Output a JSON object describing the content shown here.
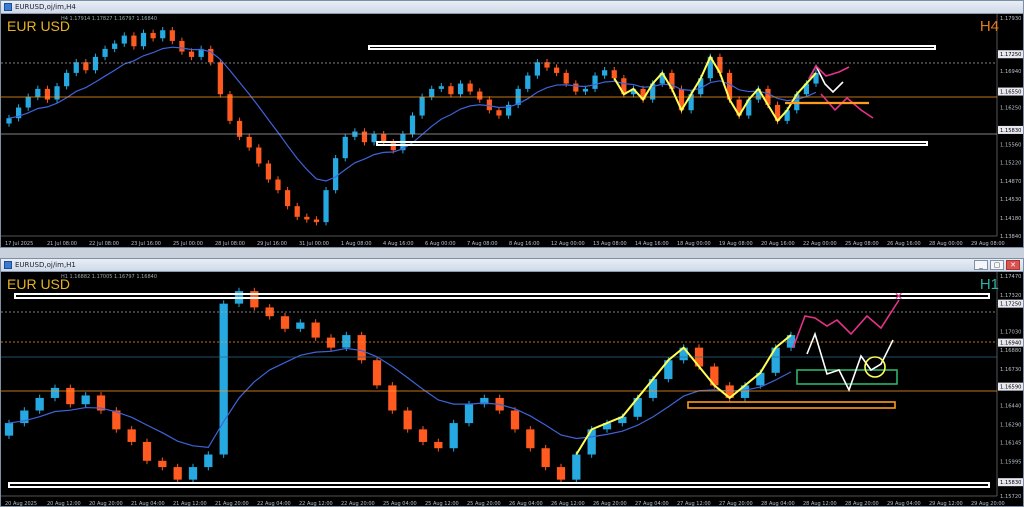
{
  "colors": {
    "bull": "#26a9e0",
    "bear": "#ff5a1f",
    "ma": "#3f63d8",
    "zigzag": "#ffff55",
    "white": "#ffffff",
    "magenta": "#e8318a",
    "orange": "#ff9a1a",
    "green": "#2db36a",
    "grid": "#1a1a1a",
    "axis_text": "#b9c0c8"
  },
  "h4": {
    "title": "EURUSD,oj/im,H4",
    "symbol_label": "EUR USD",
    "timeframe_label": "H4",
    "ohlc_text": "H4 1.17914 1.17827 1.16797 1.16840",
    "price_labels": [
      "1.17930",
      "1.17250",
      "1.16940",
      "1.16550",
      "1.16250",
      "1.15830",
      "1.15560",
      "1.15220",
      "1.14870",
      "1.14530",
      "1.14180",
      "1.13840"
    ],
    "highlight_labels": [
      "1.17250",
      "1.16550",
      "1.15830"
    ],
    "time_labels": [
      "17 Jul 2025",
      "21 Jul 08:00",
      "22 Jul 08:00",
      "23 Jul 16:00",
      "25 Jul 00:00",
      "28 Jul 08:00",
      "29 Jul 16:00",
      "31 Jul 00:00",
      "1 Aug 08:00",
      "4 Aug 16:00",
      "6 Aug 00:00",
      "7 Aug 08:00",
      "8 Aug 16:00",
      "12 Aug 00:00",
      "13 Aug 08:00",
      "14 Aug 16:00",
      "18 Aug 00:00",
      "19 Aug 08:00",
      "20 Aug 16:00",
      "22 Aug 00:00",
      "25 Aug 08:00",
      "26 Aug 16:00",
      "28 Aug 00:00",
      "29 Aug 08:00"
    ]
  },
  "h1": {
    "title": "EURUSD,oj/im,H1",
    "symbol_label": "EUR USD",
    "timeframe_label": "H1",
    "ohlc_text": "H1 1.16882 1.17005 1.16797 1.16840",
    "price_labels": [
      "1.17470",
      "1.17320",
      "1.17250",
      "1.17030",
      "1.16940",
      "1.16880",
      "1.16730",
      "1.16590",
      "1.16440",
      "1.16290",
      "1.16145",
      "1.15995",
      "1.15830",
      "1.15720"
    ],
    "highlight_labels": [
      "1.17250",
      "1.16940",
      "1.16590",
      "1.15830"
    ],
    "time_labels": [
      "20 Aug 2025",
      "20 Aug 12:00",
      "20 Aug 20:00",
      "21 Aug 04:00",
      "21 Aug 12:00",
      "21 Aug 20:00",
      "22 Aug 04:00",
      "22 Aug 12:00",
      "22 Aug 20:00",
      "25 Aug 04:00",
      "25 Aug 12:00",
      "25 Aug 20:00",
      "26 Aug 04:00",
      "26 Aug 12:00",
      "26 Aug 20:00",
      "27 Aug 04:00",
      "27 Aug 12:00",
      "27 Aug 20:00",
      "28 Aug 04:00",
      "28 Aug 12:00",
      "28 Aug 20:00",
      "29 Aug 04:00",
      "29 Aug 12:00",
      "29 Aug 20:00"
    ]
  },
  "window_buttons": [
    "_",
    "▢",
    "✕"
  ],
  "chart_data": [
    {
      "type": "candlestick",
      "title": "EURUSD,oj/im,H4",
      "ylim": [
        1.1384,
        1.1793
      ],
      "series": [
        {
          "name": "close",
          "values": [
            1.1605,
            1.1625,
            1.1645,
            1.166,
            1.164,
            1.1665,
            1.169,
            1.171,
            1.1695,
            1.172,
            1.1735,
            1.1745,
            1.176,
            1.174,
            1.1765,
            1.1755,
            1.177,
            1.175,
            1.173,
            1.172,
            1.1735,
            1.171,
            1.165,
            1.16,
            1.157,
            1.155,
            1.152,
            1.149,
            1.147,
            1.144,
            1.142,
            1.1415,
            1.141,
            1.147,
            1.153,
            1.157,
            1.158,
            1.156,
            1.1575,
            1.156,
            1.1545,
            1.1575,
            1.161,
            1.1645,
            1.166,
            1.1665,
            1.165,
            1.167,
            1.1655,
            1.164,
            1.162,
            1.161,
            1.163,
            1.166,
            1.1685,
            1.171,
            1.17,
            1.169,
            1.167,
            1.1655,
            1.166,
            1.1685,
            1.1695,
            1.168,
            1.165,
            1.166,
            1.164,
            1.167,
            1.169,
            1.166,
            1.162,
            1.165,
            1.168,
            1.172,
            1.169,
            1.164,
            1.161,
            1.164,
            1.166,
            1.163,
            1.16,
            1.162,
            1.165,
            1.167,
            1.169
          ]
        }
      ]
    },
    {
      "type": "candlestick",
      "title": "EURUSD,oj/im,H1",
      "ylim": [
        1.1572,
        1.1747
      ],
      "series": [
        {
          "name": "close",
          "values": [
            1.163,
            1.164,
            1.165,
            1.1658,
            1.1645,
            1.1652,
            1.164,
            1.1625,
            1.1615,
            1.16,
            1.1595,
            1.1585,
            1.1595,
            1.1605,
            1.1725,
            1.1735,
            1.1722,
            1.1715,
            1.1705,
            1.171,
            1.1698,
            1.169,
            1.17,
            1.168,
            1.166,
            1.164,
            1.1625,
            1.1615,
            1.161,
            1.163,
            1.1645,
            1.165,
            1.164,
            1.1625,
            1.161,
            1.1595,
            1.1585,
            1.1605,
            1.1625,
            1.163,
            1.1635,
            1.165,
            1.1665,
            1.168,
            1.169,
            1.1675,
            1.166,
            1.165,
            1.166,
            1.167,
            1.169,
            1.17
          ]
        }
      ]
    }
  ]
}
